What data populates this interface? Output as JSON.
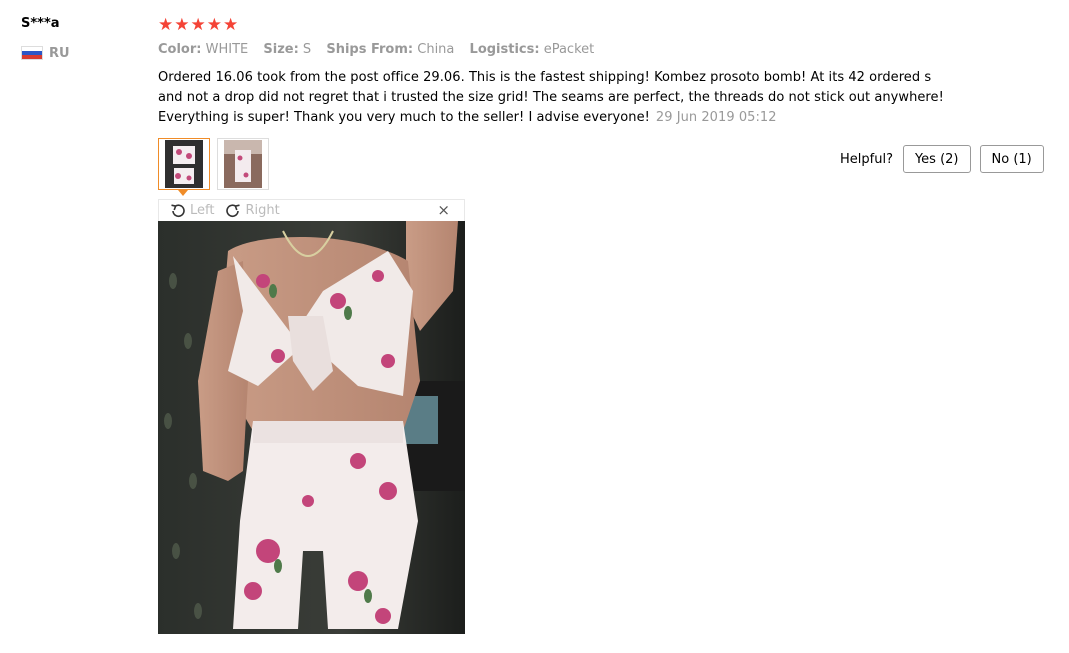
{
  "review": {
    "user_name": "S***a",
    "country_code": "RU",
    "rating_stars": 5,
    "attributes": [
      {
        "key": "Color:",
        "value": "WHITE"
      },
      {
        "key": "Size:",
        "value": "S"
      },
      {
        "key": "Ships From:",
        "value": "China"
      },
      {
        "key": "Logistics:",
        "value": "ePacket"
      }
    ],
    "text": "Ordered 16.06 took from the post office 29.06. This is the fastest shipping! Kombez prosoto bomb! At its 42 ordered s and not a drop did not regret that i trusted the size grid! The seams are perfect, the threads do not stick out anywhere! Everything is super! Thank you very much to the seller! I advise everyone!",
    "date": "29 Jun 2019 05:12"
  },
  "helpful": {
    "label": "Helpful?",
    "yes_label": "Yes (2)",
    "no_label": "No (1)"
  },
  "viewer": {
    "rotate_left_label": "Left",
    "rotate_right_label": "Right",
    "close_symbol": "×"
  },
  "colors": {
    "star": "#f44336",
    "accent_thumb_border": "#f08c28"
  }
}
